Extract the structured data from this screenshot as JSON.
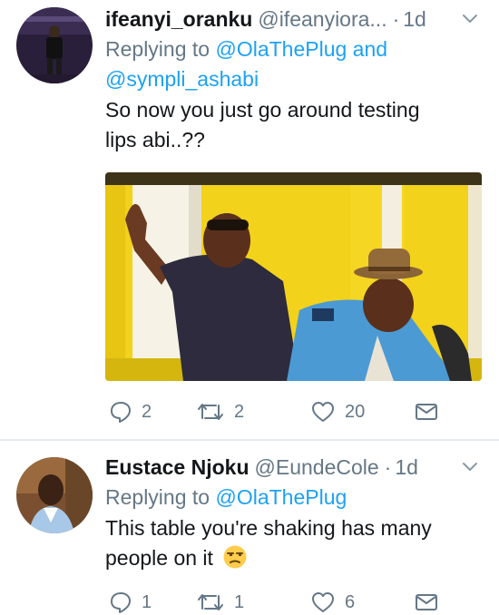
{
  "tweets": [
    {
      "name": "ifeanyi_oranku",
      "handle": "@ifeanyiora...",
      "separator": "·",
      "time": "1d",
      "replying_prefix": "Replying to ",
      "replying_mentions": [
        "@OlaThePlug",
        "@sympli_ashabi"
      ],
      "replying_joiner": " and",
      "text_lines": [
        "So now you just go around testing",
        "lips abi..??"
      ],
      "has_media": true,
      "actions": {
        "replies": "2",
        "retweets": "2",
        "likes": "20"
      }
    },
    {
      "name": "Eustace Njoku",
      "handle": "@EundeCole",
      "separator": "·",
      "time": "1d",
      "replying_prefix": "Replying to ",
      "replying_mentions": [
        "@OlaThePlug"
      ],
      "text_lines": [
        "This table you're shaking has many",
        "people on it"
      ],
      "emoji": "unamused-face",
      "has_media": false,
      "actions": {
        "replies": "1",
        "retweets": "1",
        "likes": "6"
      }
    }
  ],
  "icons": [
    "reply-icon",
    "retweet-icon",
    "like-icon",
    "direct-message-icon",
    "caret-down-icon"
  ],
  "colors": {
    "link": "#1da1f2",
    "secondary": "#657786",
    "text": "#14171a",
    "divider": "#e6ecf0"
  }
}
